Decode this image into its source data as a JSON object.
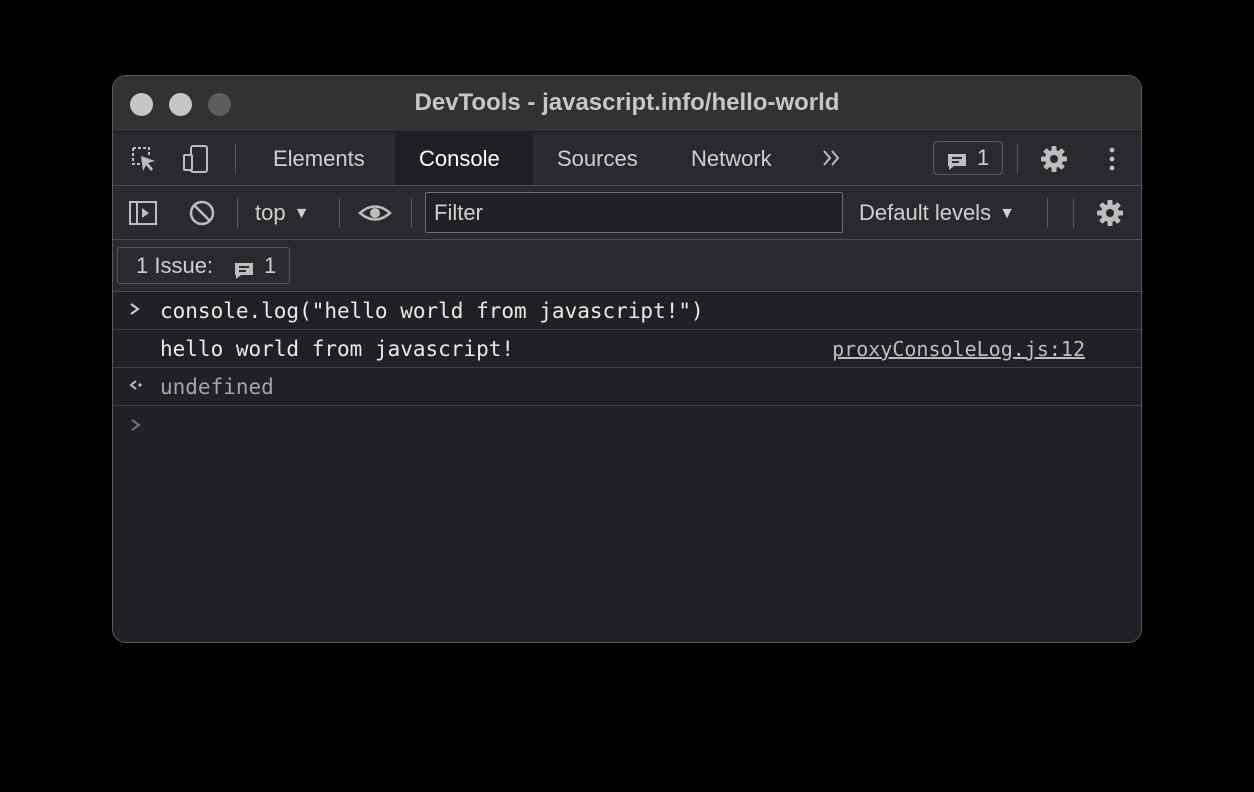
{
  "window": {
    "title": "DevTools - javascript.info/hello-world"
  },
  "tabs": [
    {
      "label": "Elements",
      "active": false
    },
    {
      "label": "Console",
      "active": true
    },
    {
      "label": "Sources",
      "active": false
    },
    {
      "label": "Network",
      "active": false
    }
  ],
  "tabbar": {
    "more_icon": "double-chevron-right-icon",
    "issues_count": "1"
  },
  "toolbar": {
    "context": "top",
    "filter_placeholder": "Filter",
    "levels": "Default levels"
  },
  "issues": {
    "label": "1 Issue:",
    "count": "1"
  },
  "console": {
    "rows": [
      {
        "kind": "input",
        "text": "console.log(\"hello world from javascript!\")"
      },
      {
        "kind": "log",
        "text": "hello world from javascript!",
        "source": "proxyConsoleLog.js:12"
      },
      {
        "kind": "result",
        "text": "undefined"
      }
    ]
  },
  "colors": {
    "background": "#202124",
    "toolbar": "#292a2d",
    "titlebar": "#323233"
  }
}
